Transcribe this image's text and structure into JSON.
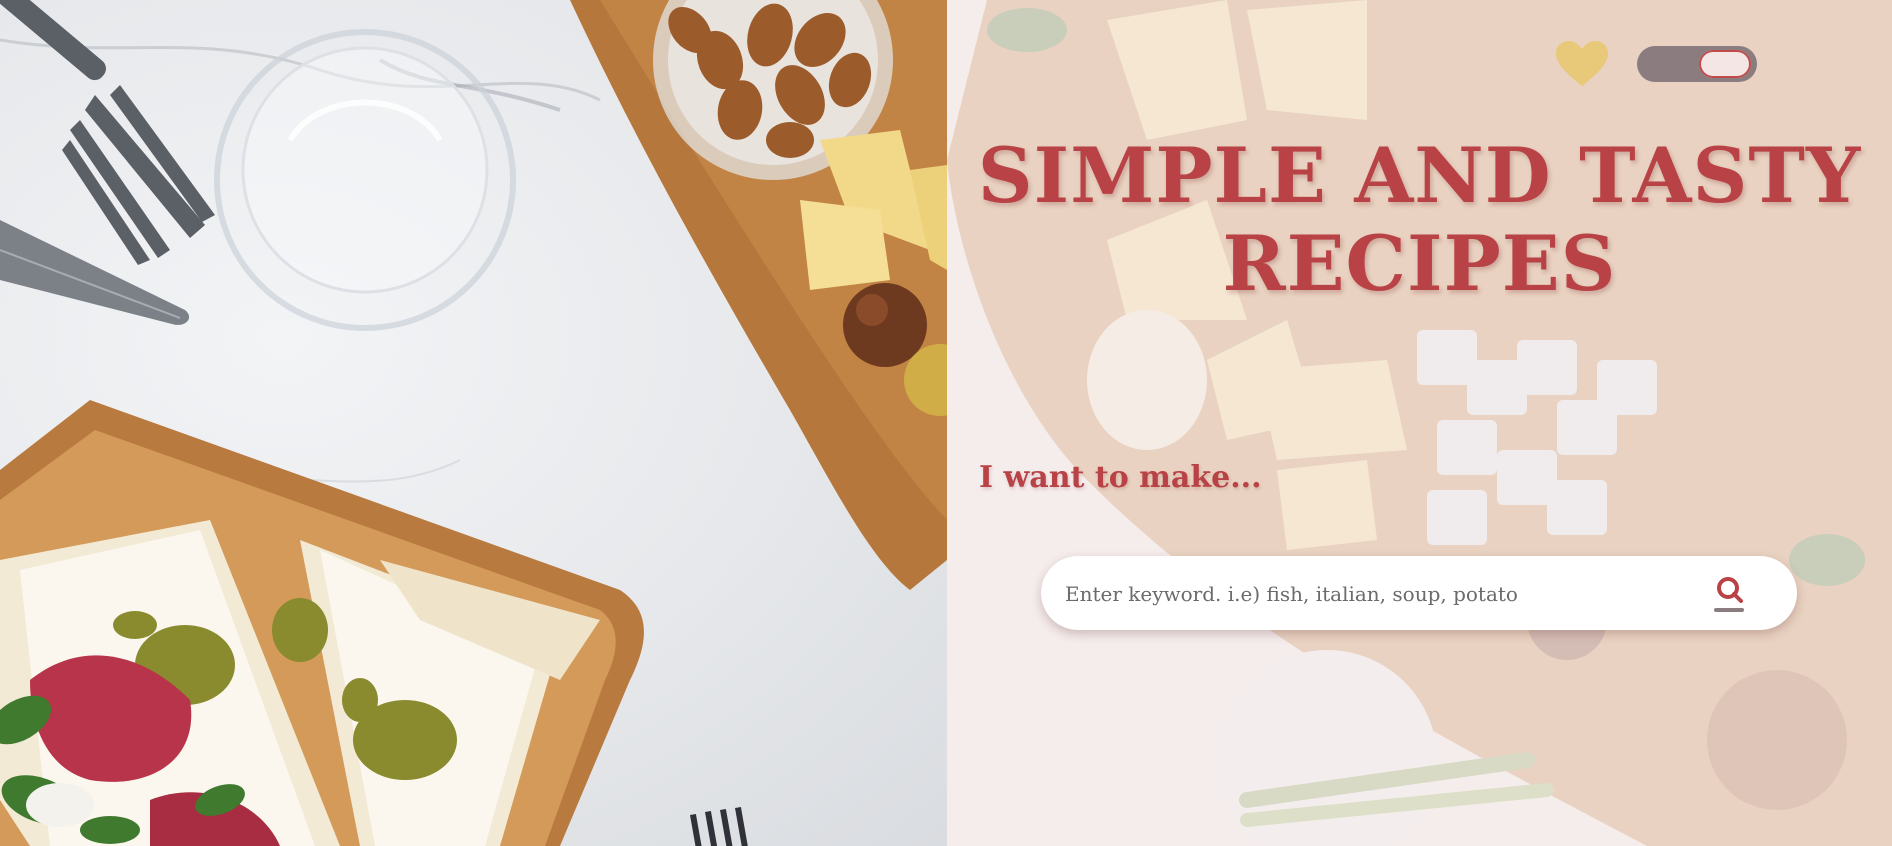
{
  "header": {
    "favorites_icon": "heart-icon",
    "theme_toggle_icon": "toggle-switch"
  },
  "hero": {
    "title_line_1": "SIMPLE AND TASTY",
    "title_line_2": "RECIPES",
    "subtitle": "I want to make..."
  },
  "search": {
    "placeholder": "Enter keyword. i.e) fish, italian, soup, potato",
    "value": "",
    "button_icon": "search-icon"
  },
  "colors": {
    "accent": "#b84245",
    "heart": "#e8c97a",
    "toggle_track": "#8a7c7f",
    "overlay": "#f6eeee"
  }
}
